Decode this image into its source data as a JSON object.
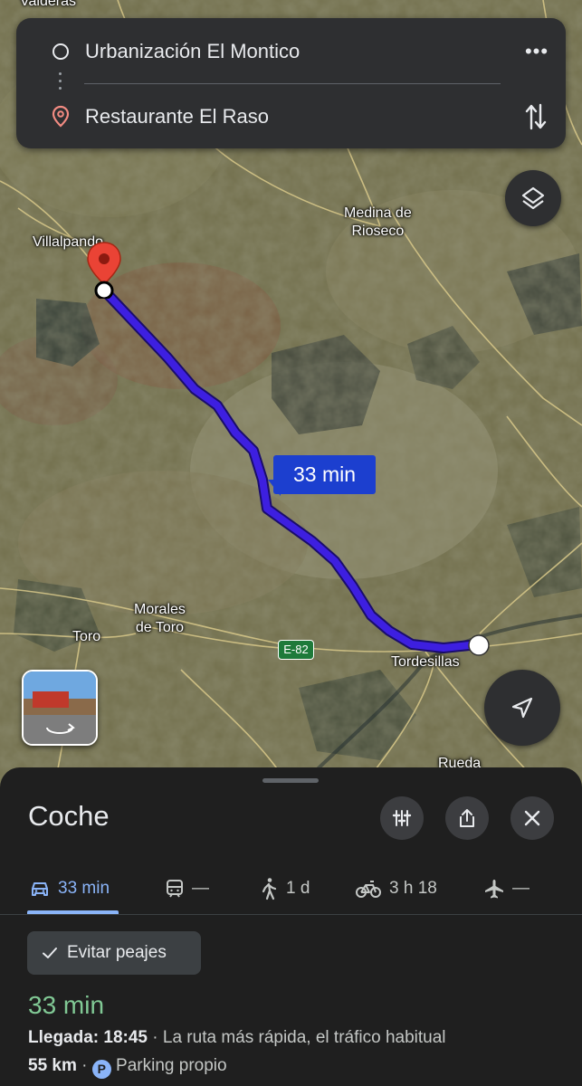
{
  "route": {
    "origin": "Urbanización El Montico",
    "destination": "Restaurante El Raso",
    "more_label": "•••"
  },
  "map": {
    "places": {
      "valderas": "Valderas",
      "medina_1": "Medina de",
      "medina_2": "Rioseco",
      "villalpando": "Villalpando",
      "morales_1": "Morales",
      "morales_2": "de Toro",
      "toro": "Toro",
      "tordesillas": "Tordesillas",
      "rueda": "Rueda"
    },
    "road_shield": "E-82",
    "time_bubble": "33 min",
    "route_color": "#3d1fe0"
  },
  "sheet": {
    "title": "Coche",
    "tabs": [
      {
        "mode": "car-icon",
        "label": "33 min"
      },
      {
        "mode": "transit-icon",
        "label": "—"
      },
      {
        "mode": "walk-icon",
        "label": "1 d"
      },
      {
        "mode": "bike-icon",
        "label": "3 h 18"
      },
      {
        "mode": "flight-icon",
        "label": "—"
      }
    ],
    "chip_label": "Evitar peajes",
    "duration": "33 min",
    "arrival_label": "Llegada: 18:45",
    "separator": " · ",
    "route_note": "La ruta más rápida, el tráfico habitual",
    "distance": "55 km",
    "parking_letter": "P",
    "parking_label": "Parking propio"
  },
  "colors": {
    "accent": "#8ab4f8",
    "duration_green": "#81c995",
    "pin_red": "#ea4335"
  }
}
